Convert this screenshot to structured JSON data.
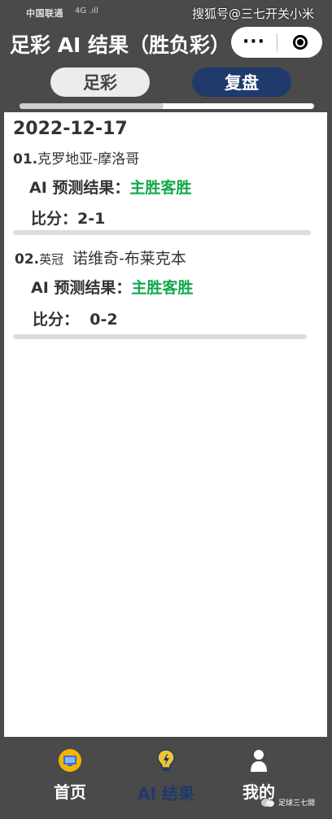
{
  "status_bar": {
    "carrier": "中国联通",
    "signal_text": "4G .ıll",
    "watermark": "搜狐号@三七开关小米"
  },
  "header": {
    "title": "足彩 AI 结果（胜负彩）",
    "more_label": "···"
  },
  "tabs": [
    {
      "label": "足彩",
      "active": false
    },
    {
      "label": "复盘",
      "active": true
    }
  ],
  "content": {
    "date": "2022-12-17",
    "matches": [
      {
        "index": "01.",
        "league": "",
        "teams": "克罗地亚-摩洛哥",
        "prediction_label": "AI 预测结果：",
        "prediction_value": "主胜客胜",
        "score_label": "比分：",
        "score_value": "2-1"
      },
      {
        "index": "02.",
        "league": "英冠",
        "teams": "诺维奇-布莱克本",
        "prediction_label": "AI 预测结果：",
        "prediction_value": "主胜客胜",
        "score_label": "比分：",
        "score_value": "0-2"
      }
    ]
  },
  "bottom_nav": [
    {
      "label": "首页",
      "icon": "monitor-icon",
      "color": "#ffffff"
    },
    {
      "label": "AI 结果",
      "icon": "bulb-icon",
      "color": "#1f3a6b"
    },
    {
      "label": "我的",
      "icon": "user-icon",
      "color": "#ffffff"
    }
  ],
  "corner_mark": "足球三七開",
  "colors": {
    "accent": "#1f3a6b",
    "prediction": "#12a84a",
    "background": "#4a4a4a"
  }
}
